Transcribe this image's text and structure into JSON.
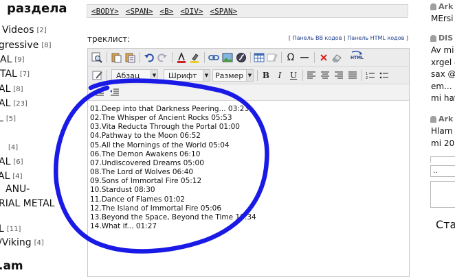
{
  "left_sidebar": {
    "header": "раздела",
    "categories": [
      {
        "label": "Videos",
        "count": "[2]"
      },
      {
        "label": "gressive",
        "count": "[8]"
      },
      {
        "label": "AL",
        "count": "[9]"
      },
      {
        "label": "TAL",
        "count": "[7]"
      },
      {
        "label": "AL",
        "count": "[8]"
      },
      {
        "label": "AL",
        "count": "[23]"
      },
      {
        "label": "L",
        "count": "[5]"
      },
      {
        "label": "",
        "count": "[4]"
      },
      {
        "label": "AL",
        "count": "[6]"
      },
      {
        "label": "AL",
        "count": "[4]"
      },
      {
        "label": "ANU-",
        "count": ""
      },
      {
        "label": "RIAL METAL",
        "count": ""
      },
      {
        "label": "L",
        "count": "[11]"
      },
      {
        "label": "/Viking",
        "count": "[4]"
      }
    ],
    "footer": ".am"
  },
  "pathbar": {
    "tags": [
      "<BODY>",
      "<SPAN>",
      "<B>",
      "<DIV>",
      "<SPAN>"
    ]
  },
  "editor": {
    "label": "треклист:",
    "panels": {
      "bracket_open": "[",
      "bb_link": "Панель BB кодов",
      "divider": "|",
      "html_link": "Панель HTML кодов",
      "bracket_close": "]"
    },
    "toolbar": {
      "format_dropdown": "Абзац",
      "font_dropdown": "Шрифт",
      "size_dropdown": "Размер",
      "bold": "B",
      "italic": "I",
      "underline": "U",
      "omega": "Ω",
      "html_label": "HTML",
      "dropdown_arrow": "▼"
    },
    "tracks": [
      "01.Deep into that Darkness Peering... 03:23",
      "02.The Whisper of Ancient Rocks 05:53",
      "03.Vita Reducta Through the Portal 01:00",
      "04.Pathway to the Moon 06:52",
      "05.All the Mornings of the World 05:04",
      "06.The Demon Awakens 06:10",
      "07.Undiscovered Dreams 05:00",
      "08.The Lord of Wolves 06:40",
      "09.Sons of Immortal Fire 05:12",
      "10.Stardust 08:30",
      "11.Dance of Flames 01:02",
      "12.The Island of Immortal Fire 05:06",
      "13.Beyond the Space, Beyond the Time 10:34",
      "14.What if... 01:27"
    ]
  },
  "right_sidebar": {
    "comments": [
      {
        "author": "Ark",
        "lines": [
          "MErsi"
        ]
      },
      {
        "author": "DIS",
        "lines": [
          "Av mi",
          "xrgel c",
          "sax @",
          "em...",
          "mi hat"
        ]
      },
      {
        "author": "Ark",
        "lines": [
          "Hlam",
          "mi 20"
        ]
      }
    ],
    "input_value": "..",
    "section_title": "Ста"
  },
  "colors": {
    "scribble": "#1a1ae6",
    "toolbar_bg": "#ececec",
    "link": "#1a3a8a"
  }
}
